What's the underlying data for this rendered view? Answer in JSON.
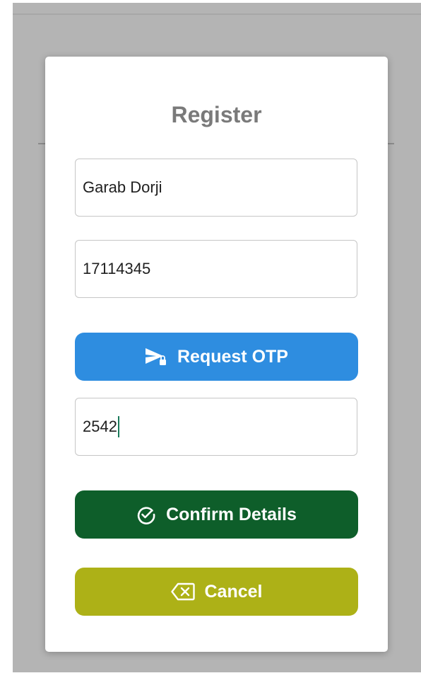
{
  "dialog": {
    "title": "Register",
    "name_field": {
      "value": "Garab Dorji"
    },
    "phone_field": {
      "value": "17114345"
    },
    "request_otp_button": {
      "label": "Request OTP",
      "icon": "send-lock-icon"
    },
    "otp_field": {
      "value": "2542"
    },
    "confirm_button": {
      "label": "Confirm Details",
      "icon": "check-circle-icon"
    },
    "cancel_button": {
      "label": "Cancel",
      "icon": "backspace-icon"
    }
  },
  "colors": {
    "request_otp": "#2e8de0",
    "confirm": "#0e5e2a",
    "cancel": "#adb117",
    "title": "#7a7a7a"
  }
}
